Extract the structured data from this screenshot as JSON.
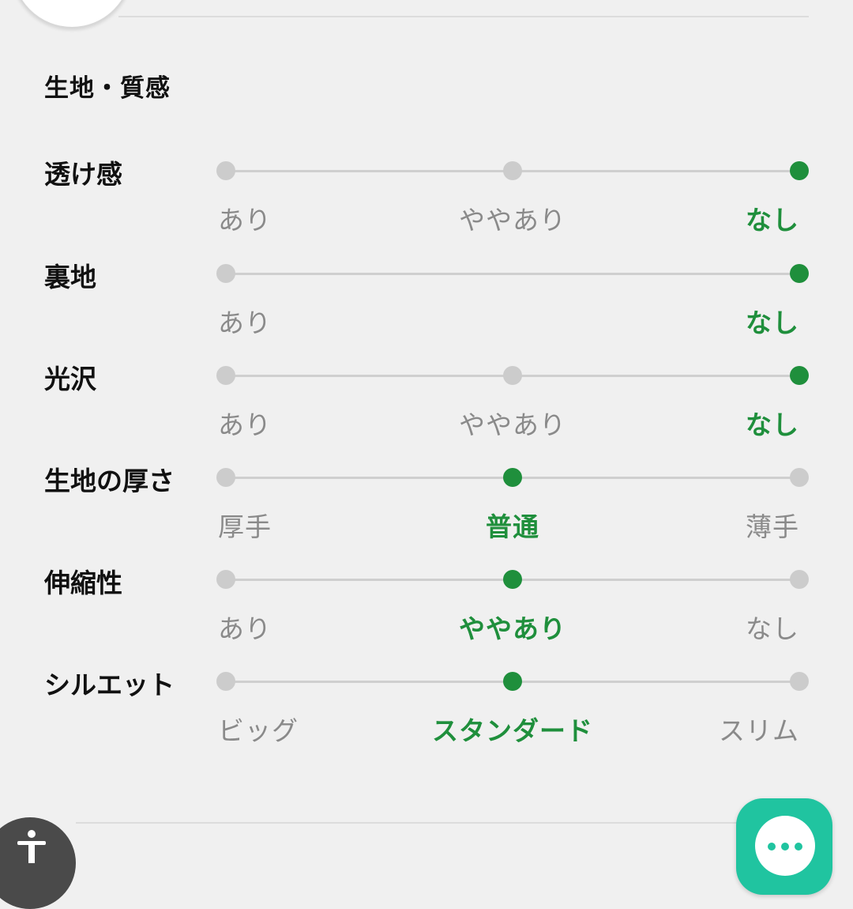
{
  "section": {
    "title": "生地・質感"
  },
  "attributes": [
    {
      "label": "透け感",
      "options": [
        "あり",
        "ややあり",
        "なし"
      ],
      "selected_index": 2
    },
    {
      "label": "裏地",
      "options": [
        "あり",
        "なし"
      ],
      "selected_index": 1
    },
    {
      "label": "光沢",
      "options": [
        "あり",
        "ややあり",
        "なし"
      ],
      "selected_index": 2
    },
    {
      "label": "生地の厚さ",
      "options": [
        "厚手",
        "普通",
        "薄手"
      ],
      "selected_index": 1
    },
    {
      "label": "伸縮性",
      "options": [
        "あり",
        "ややあり",
        "なし"
      ],
      "selected_index": 1
    },
    {
      "label": "シルエット",
      "options": [
        "ビッグ",
        "スタンダード",
        "スリム"
      ],
      "selected_index": 1
    }
  ],
  "icons": {
    "zoom": "magnifier-icon",
    "accessibility": "accessibility-icon",
    "chat": "chat-bubble-icon"
  },
  "colors": {
    "accent": "#1f8f3c",
    "inactive_dot": "#cccccc",
    "inactive_text": "#8a8a8a",
    "chat_fab": "#20c4a0"
  }
}
